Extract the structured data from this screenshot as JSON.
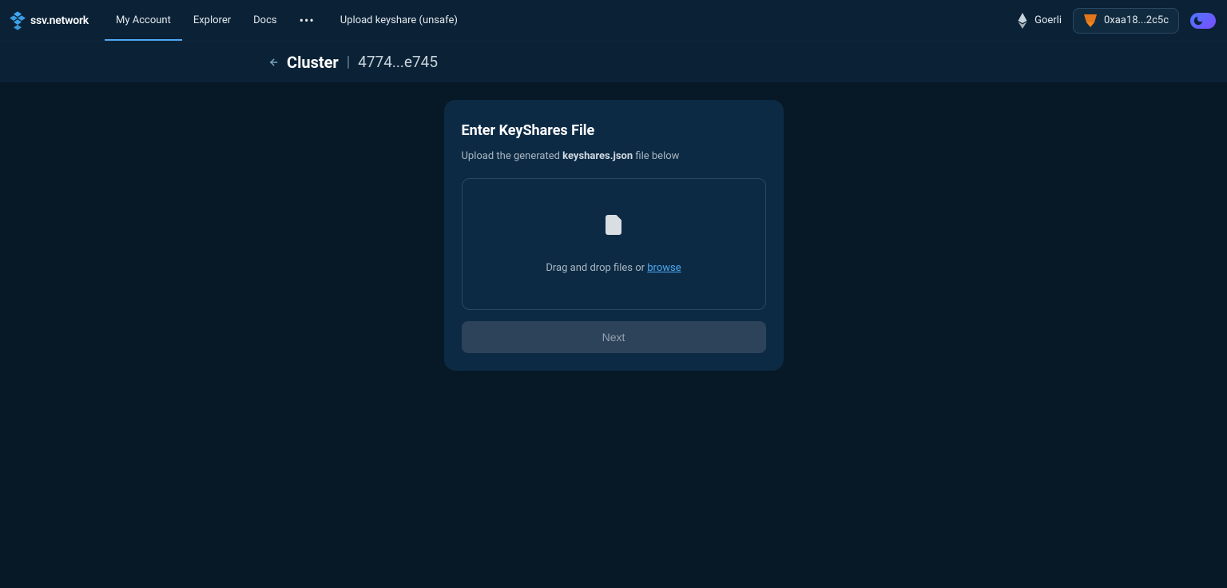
{
  "brand": {
    "name": "ssv.network"
  },
  "nav": {
    "my_account": "My Account",
    "explorer": "Explorer",
    "docs": "Docs",
    "upload": "Upload keyshare (unsafe)"
  },
  "network": {
    "name": "Goerli"
  },
  "wallet": {
    "address": "0xaa18...2c5c"
  },
  "subheader": {
    "back_name": "back",
    "cluster_label": "Cluster",
    "separator": "|",
    "cluster_id": "4774...e745"
  },
  "card": {
    "title": "Enter KeyShares File",
    "sub_prefix": "Upload the generated ",
    "sub_bold": "keyshares.json",
    "sub_suffix": " file below",
    "drop_prefix": "Drag and drop files or ",
    "browse": "browse",
    "next": "Next"
  }
}
